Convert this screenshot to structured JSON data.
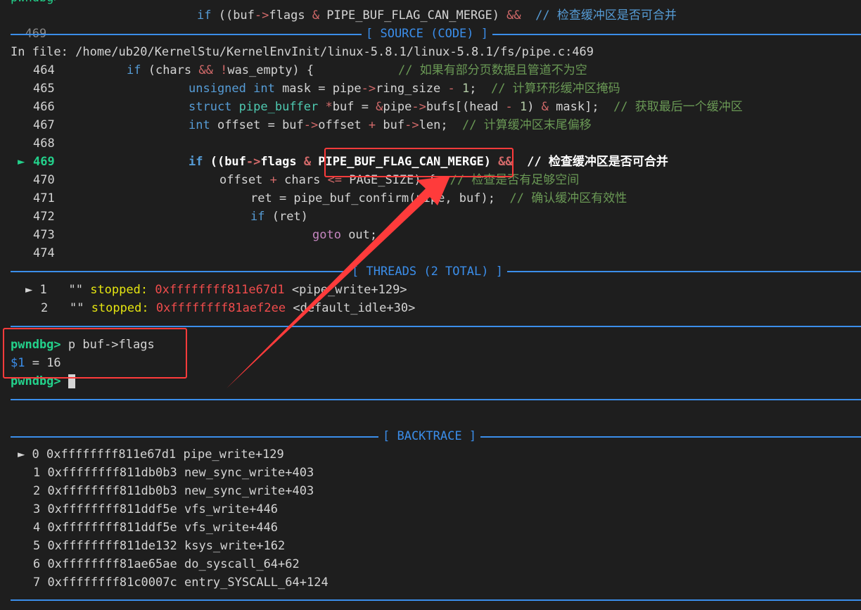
{
  "top": {
    "prompt_cut": "pwndbg>",
    "line_no": "469",
    "code_a": "if ((buf->flags & PIPE_BUF_FLAG_CAN_MERGE) &&",
    "comment": "// 检查缓冲区是否可合并"
  },
  "source": {
    "header": "[ SOURCE (CODE) ]",
    "file": "In file: /home/ub20/KernelStu/KernelEnvInit/linux-5.8.1/linux-5.8.1/fs/pipe.c:469",
    "lines": [
      {
        "no": "464",
        "marker": ""
      },
      {
        "no": "465",
        "marker": ""
      },
      {
        "no": "466",
        "marker": ""
      },
      {
        "no": "467",
        "marker": ""
      },
      {
        "no": "468",
        "marker": ""
      },
      {
        "no": "469",
        "marker": "►"
      },
      {
        "no": "470",
        "marker": ""
      },
      {
        "no": "471",
        "marker": ""
      },
      {
        "no": "472",
        "marker": ""
      },
      {
        "no": "473",
        "marker": ""
      },
      {
        "no": "474",
        "marker": ""
      }
    ],
    "code": {
      "l464": {
        "a": "if",
        "b": " (chars ",
        "c": "&& !",
        "d": "was_empty) {",
        "cm": "// 如果有部分页数据且管道不为空"
      },
      "l465": {
        "a": "unsigned int",
        "b": " mask = pipe",
        "c": "->",
        "d": "ring_size ",
        "e": "-",
        "f": " 1",
        "g": ";",
        "cm": "// 计算环形缓冲区掩码"
      },
      "l466": {
        "a": "struct",
        "b": "pipe_buffer",
        "c": " *",
        "d": "buf = ",
        "e": "&",
        "f": "pipe",
        "g": "->",
        "h": "bufs[(head ",
        "i": "-",
        "j": " 1",
        "k": ") ",
        "l": "&",
        "m": " mask];",
        "cm": "// 获取最后一个缓冲区"
      },
      "l467": {
        "a": "int",
        "b": " offset = buf",
        "c": "->",
        "d": "offset ",
        "e": "+",
        "f": " buf",
        "g": "->",
        "h": "len;",
        "cm": "// 计算缓冲区末尾偏移"
      },
      "l469": {
        "a": "if",
        "b": " ((buf",
        "c": "->",
        "d": "flags ",
        "e": "&",
        "f": " PIPE_BUF_FLAG_CAN_MERGE)",
        "g": " &&",
        "cm": "// 检查缓冲区是否可合并"
      },
      "l470": {
        "a": "offset ",
        "b": "+",
        "c": " chars ",
        "d": "<=",
        "e": " PAGE_SIZE) {",
        "cm": "// 检查是否有足够空间"
      },
      "l471": {
        "a": "ret = pipe_buf_confirm(pipe, buf);",
        "cm": "// 确认缓冲区有效性"
      },
      "l472": {
        "a": "if",
        "b": " (ret)"
      },
      "l473": {
        "a": "goto",
        "b": " out;"
      }
    }
  },
  "threads": {
    "header": "[ THREADS (2 TOTAL) ]",
    "items": [
      {
        "marker": "►",
        "id": "1",
        "name": "\"\"",
        "state": "stopped:",
        "addr": "0xffffffff811e67d1",
        "sym": "<pipe_write+129>"
      },
      {
        "marker": "",
        "id": "2",
        "name": "\"\"",
        "state": "stopped:",
        "addr": "0xffffffff81aef2ee",
        "sym": "<default_idle+30>"
      }
    ]
  },
  "console": {
    "prompt": "pwndbg>",
    "command": " p buf->flags",
    "result_var": "$1",
    "result_rest": " = 16",
    "prompt2": "pwndbg>"
  },
  "backtrace": {
    "header": "[ BACKTRACE ]",
    "frames": [
      {
        "marker": "►",
        "idx": "0",
        "addr": "0xffffffff811e67d1",
        "sym": "pipe_write+129"
      },
      {
        "marker": "",
        "idx": "1",
        "addr": "0xffffffff811db0b3",
        "sym": "new_sync_write+403"
      },
      {
        "marker": "",
        "idx": "2",
        "addr": "0xffffffff811db0b3",
        "sym": "new_sync_write+403"
      },
      {
        "marker": "",
        "idx": "3",
        "addr": "0xffffffff811ddf5e",
        "sym": "vfs_write+446"
      },
      {
        "marker": "",
        "idx": "4",
        "addr": "0xffffffff811ddf5e",
        "sym": "vfs_write+446"
      },
      {
        "marker": "",
        "idx": "5",
        "addr": "0xffffffff811de132",
        "sym": "ksys_write+162"
      },
      {
        "marker": "",
        "idx": "6",
        "addr": "0xffffffff81ae65ae",
        "sym": "do_syscall_64+62"
      },
      {
        "marker": "",
        "idx": "7",
        "addr": "0xffffffff81c0007c",
        "sym": "entry_SYSCALL_64+124"
      }
    ]
  },
  "annotation": {
    "color": "#ff3b3b",
    "icon": "arrow-icon"
  }
}
